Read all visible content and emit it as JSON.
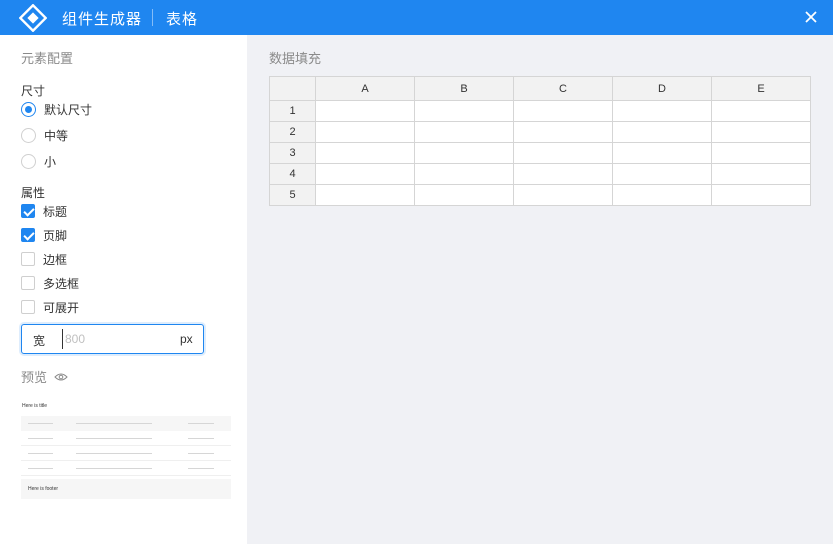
{
  "header": {
    "app_title": "组件生成器",
    "page_title": "表格",
    "bg_color": "#1f86f0"
  },
  "left": {
    "section_title": "元素配置",
    "size": {
      "label": "尺寸",
      "options": [
        "默认尺寸",
        "中等",
        "小"
      ],
      "selected": "默认尺寸"
    },
    "attrs": {
      "label": "属性",
      "items": [
        {
          "label": "标题",
          "checked": true
        },
        {
          "label": "页脚",
          "checked": true
        },
        {
          "label": "边框",
          "checked": false
        },
        {
          "label": "多选框",
          "checked": false
        },
        {
          "label": "可展开",
          "checked": false
        }
      ]
    },
    "width": {
      "label": "宽",
      "value": "",
      "placeholder": "800",
      "unit": "px"
    },
    "preview": {
      "title": "预览",
      "table_title": "Here is title",
      "table_footer": "Here is footer"
    }
  },
  "right": {
    "title": "数据填充",
    "columns": [
      "A",
      "B",
      "C",
      "D",
      "E"
    ],
    "rows": [
      {
        "label": "1",
        "cells": [
          "",
          "",
          "",
          "",
          ""
        ]
      },
      {
        "label": "2",
        "cells": [
          "",
          "",
          "",
          "",
          ""
        ]
      },
      {
        "label": "3",
        "cells": [
          "",
          "",
          "",
          "",
          ""
        ]
      },
      {
        "label": "4",
        "cells": [
          "",
          "",
          "",
          "",
          ""
        ]
      },
      {
        "label": "5",
        "cells": [
          "",
          "",
          "",
          "",
          ""
        ]
      }
    ]
  }
}
